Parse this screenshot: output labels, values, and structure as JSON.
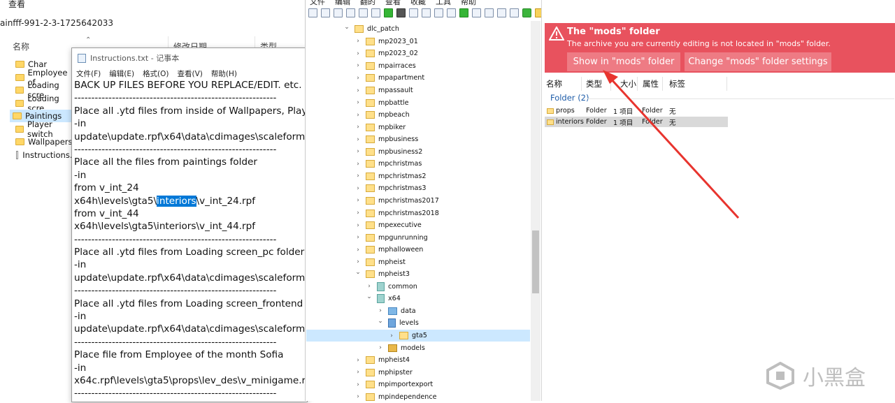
{
  "explorer": {
    "menu_view": "查看",
    "path": "ainfff-991-2-3-1725642033",
    "col_name": "名称",
    "col_date": "修改日期",
    "col_type": "类型",
    "items": [
      {
        "label": "Char",
        "kind": "folder"
      },
      {
        "label": "Employee of",
        "kind": "folder"
      },
      {
        "label": "Loading scre",
        "kind": "folder"
      },
      {
        "label": "Loading scre",
        "kind": "folder"
      },
      {
        "label": "Paintings",
        "kind": "folder"
      },
      {
        "label": "Player switch",
        "kind": "folder"
      },
      {
        "label": "Wallpapers",
        "kind": "folder"
      },
      {
        "label": "Instructions.t",
        "kind": "file"
      }
    ],
    "selected_index": 4
  },
  "notepad": {
    "title": "Instructions.txt - 记事本",
    "menu": [
      "文件(F)",
      "编辑(E)",
      "格式(O)",
      "查看(V)",
      "帮助(H)"
    ],
    "lines": [
      "BACK UP FILES BEFORE YOU REPLACE/EDIT. etc.",
      "-----------------------------------------------------------",
      "Place all .ytd files from inside of Wallpapers, Player",
      "-in",
      "update\\update.rpf\\x64\\data\\cdimages\\scaleform",
      "-----------------------------------------------------------",
      "Place all the files from paintings folder",
      "-in",
      "from v_int_24",
      "",
      "from v_int_44",
      "x64h\\levels\\gta5\\interiors\\v_int_44.rpf",
      "-----------------------------------------------------------",
      "Place all .ytd files from Loading screen_pc folder",
      "-in",
      "update\\update.rpf\\x64\\data\\cdimages\\scaleform",
      "-----------------------------------------------------------",
      "Place all .ytd files from Loading screen_frontend f",
      "-in",
      "update\\update.rpf\\x64\\data\\cdimages\\scaleform",
      "-----------------------------------------------------------",
      "Place file from Employee of the month Sofia",
      "-in",
      "x64c.rpf\\levels\\gta5\\props\\lev_des\\v_minigame.rp",
      "-----------------------------------------------------------"
    ],
    "hl_line": {
      "before": "x64h\\levels\\gta5\\",
      "highlight": "interiors",
      "after": "\\v_int_24.rpf"
    }
  },
  "tree": {
    "menu": [
      "文件",
      "编辑",
      "翻的",
      "查看",
      "收藏",
      "工具",
      "帮助"
    ],
    "rows": [
      {
        "label": "dlc_patch",
        "depth": 0,
        "chevron": "down",
        "icon": "folder"
      },
      {
        "label": "mp2023_01",
        "depth": 1,
        "chevron": "right",
        "icon": "folder"
      },
      {
        "label": "mp2023_02",
        "depth": 1,
        "chevron": "right",
        "icon": "folder"
      },
      {
        "label": "mpairraces",
        "depth": 1,
        "chevron": "right",
        "icon": "folder"
      },
      {
        "label": "mpapartment",
        "depth": 1,
        "chevron": "right",
        "icon": "folder"
      },
      {
        "label": "mpassault",
        "depth": 1,
        "chevron": "right",
        "icon": "folder"
      },
      {
        "label": "mpbattle",
        "depth": 1,
        "chevron": "right",
        "icon": "folder"
      },
      {
        "label": "mpbeach",
        "depth": 1,
        "chevron": "right",
        "icon": "folder"
      },
      {
        "label": "mpbiker",
        "depth": 1,
        "chevron": "right",
        "icon": "folder"
      },
      {
        "label": "mpbusiness",
        "depth": 1,
        "chevron": "right",
        "icon": "folder"
      },
      {
        "label": "mpbusiness2",
        "depth": 1,
        "chevron": "right",
        "icon": "folder"
      },
      {
        "label": "mpchristmas",
        "depth": 1,
        "chevron": "right",
        "icon": "folder"
      },
      {
        "label": "mpchristmas2",
        "depth": 1,
        "chevron": "right",
        "icon": "folder"
      },
      {
        "label": "mpchristmas3",
        "depth": 1,
        "chevron": "right",
        "icon": "folder"
      },
      {
        "label": "mpchristmas2017",
        "depth": 1,
        "chevron": "right",
        "icon": "folder"
      },
      {
        "label": "mpchristmas2018",
        "depth": 1,
        "chevron": "right",
        "icon": "folder"
      },
      {
        "label": "mpexecutive",
        "depth": 1,
        "chevron": "right",
        "icon": "folder"
      },
      {
        "label": "mpgunrunning",
        "depth": 1,
        "chevron": "right",
        "icon": "folder"
      },
      {
        "label": "mphalloween",
        "depth": 1,
        "chevron": "right",
        "icon": "folder"
      },
      {
        "label": "mpheist",
        "depth": 1,
        "chevron": "right",
        "icon": "folder"
      },
      {
        "label": "mpheist3",
        "depth": 1,
        "chevron": "down",
        "icon": "folder"
      },
      {
        "label": "common",
        "depth": 2,
        "chevron": "right",
        "icon": "teal"
      },
      {
        "label": "x64",
        "depth": 2,
        "chevron": "down",
        "icon": "teal"
      },
      {
        "label": "data",
        "depth": 3,
        "chevron": "right",
        "icon": "img"
      },
      {
        "label": "levels",
        "depth": 3,
        "chevron": "down",
        "icon": "lvl"
      },
      {
        "label": "gta5",
        "depth": 4,
        "chevron": "right",
        "icon": "folder"
      },
      {
        "label": "models",
        "depth": 3,
        "chevron": "right",
        "icon": "mdl"
      },
      {
        "label": "mpheist4",
        "depth": 1,
        "chevron": "right",
        "icon": "folder"
      },
      {
        "label": "mphipster",
        "depth": 1,
        "chevron": "right",
        "icon": "folder"
      },
      {
        "label": "mpimportexport",
        "depth": 1,
        "chevron": "right",
        "icon": "folder"
      },
      {
        "label": "mpindependence",
        "depth": 1,
        "chevron": "right",
        "icon": "folder"
      }
    ],
    "selected_index": 25
  },
  "right": {
    "banner": {
      "title": "The \"mods\" folder",
      "subtitle": "The archive you are currently editing is not located in \"mods\" folder.",
      "btn_show": "Show in \"mods\" folder",
      "btn_change": "Change \"mods\" folder settings",
      "color": "#e8525e"
    },
    "headers": {
      "name": "名称",
      "type": "类型",
      "size": "大小",
      "attr": "属性",
      "tag": "标签"
    },
    "group_label": "Folder (2)",
    "files": [
      {
        "name": "props",
        "type": "Folder",
        "size": "1 项目",
        "attr": "Folder",
        "tag": "无"
      },
      {
        "name": "interiors",
        "type": "Folder",
        "size": "1 项目",
        "attr": "Folder",
        "tag": "无"
      }
    ],
    "selected_file": 1
  },
  "watermark": {
    "text": "小黑盒"
  },
  "annotation_arrow_color": "#e8342e"
}
